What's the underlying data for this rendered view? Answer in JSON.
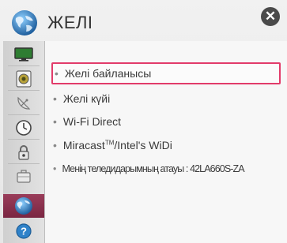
{
  "header": {
    "title": "ЖЕЛІ",
    "close_label": "✕"
  },
  "sidebar": {
    "items": [
      {
        "icon": "monitor-icon"
      },
      {
        "icon": "speaker-icon"
      },
      {
        "icon": "satellite-dish-icon"
      },
      {
        "icon": "clock-icon"
      },
      {
        "icon": "lock-icon"
      },
      {
        "icon": "briefcase-icon"
      },
      {
        "icon": "globe-icon",
        "active": true
      },
      {
        "icon": "help-icon"
      }
    ]
  },
  "menu": {
    "items": [
      {
        "label": "Желі байланысы",
        "selected": true
      },
      {
        "label": "Желі күйі"
      },
      {
        "label": "Wi-Fi Direct"
      },
      {
        "label_prefix": "Miracast",
        "label_sup": "TM",
        "label_suffix": "/Intel's WiDi"
      },
      {
        "label": "Менің теледидарымның атауы : 42LA660S-ZA"
      }
    ]
  },
  "colors": {
    "accent": "#e23b6a",
    "active_sidebar": "#8a3050"
  }
}
